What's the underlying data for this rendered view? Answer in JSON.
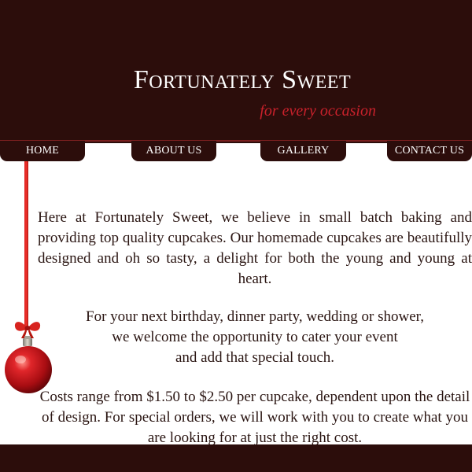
{
  "header": {
    "title": "Fortunately Sweet",
    "tagline": "for every occasion"
  },
  "nav": {
    "home": "HOME",
    "about": "ABOUT US",
    "gallery": "GALLERY",
    "contact": "CONTACT US"
  },
  "content": {
    "paragraph_1": "Here at Fortunately Sweet, we believe in small batch baking and providing top quality cupcakes. Our homemade cupcakes are beautifully designed and oh so tasty, a delight for both the young and young at heart.",
    "paragraph_2_lines": [
      "For your next birthday, dinner party, wedding or shower,",
      "we welcome the opportunity to cater your event",
      "and add that special touch."
    ],
    "paragraph_3": "Costs range from $1.50 to $2.50 per cupcake, dependent upon the detail of design. For special orders, we will work with you to create what you are looking for at just the right cost."
  },
  "colors": {
    "header_bg": "#2c0d0b",
    "tagline": "#c8212b",
    "text": "#2a1512",
    "ornament": "#c8151b"
  },
  "icons": {
    "ornament": "christmas-ornament-icon"
  }
}
